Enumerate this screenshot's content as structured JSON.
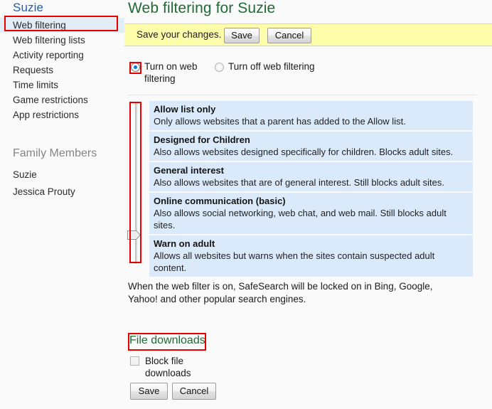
{
  "sidebar": {
    "user_title": "Suzie",
    "nav_items": [
      {
        "label": "Web filtering",
        "selected": true
      },
      {
        "label": "Web filtering lists",
        "selected": false
      },
      {
        "label": "Activity reporting",
        "selected": false
      },
      {
        "label": "Requests",
        "selected": false
      },
      {
        "label": "Time limits",
        "selected": false
      },
      {
        "label": "Game restrictions",
        "selected": false
      },
      {
        "label": "App restrictions",
        "selected": false
      }
    ],
    "group_title": "Family Members",
    "members": [
      {
        "name": "Suzie"
      },
      {
        "name": "Jessica Prouty"
      }
    ]
  },
  "main": {
    "page_title": "Web filtering for Suzie",
    "save_bar": {
      "message": "Save your changes.",
      "save_label": "Save",
      "cancel_label": "Cancel"
    },
    "filter_toggle": {
      "on_label": "Turn on web filtering",
      "off_label": "Turn off web filtering",
      "selected": "on"
    },
    "levels": [
      {
        "name": "Allow list only",
        "description": "Only allows websites that a parent has added to the Allow list."
      },
      {
        "name": "Designed for Children",
        "description": "Also allows websites designed specifically for children. Blocks adult sites."
      },
      {
        "name": "General interest",
        "description": "Also allows websites that are of general interest. Still blocks adult sites."
      },
      {
        "name": "Online communication (basic)",
        "description": "Also allows social networking, web chat, and web mail. Still blocks adult sites."
      },
      {
        "name": "Warn on adult",
        "description": "Allows all websites but warns when the sites contain suspected adult content."
      }
    ],
    "selected_level": "Warn on adult",
    "safesearch_note": "When the web filter is on, SafeSearch will be locked on in Bing, Google, Yahoo! and other popular search engines.",
    "file_downloads": {
      "section_title": "File downloads",
      "checkbox_label": "Block file downloads",
      "checked": false
    },
    "bottom_buttons": {
      "save_label": "Save",
      "cancel_label": "Cancel"
    }
  },
  "annotations": {
    "accent_color": "#e60000",
    "highlight_color": "#e3edf8",
    "heading_color": "#1e6b33",
    "link_color": "#1f5faa",
    "list_bg_color": "#daeafa",
    "save_bar_color": "#fdfdaa"
  }
}
